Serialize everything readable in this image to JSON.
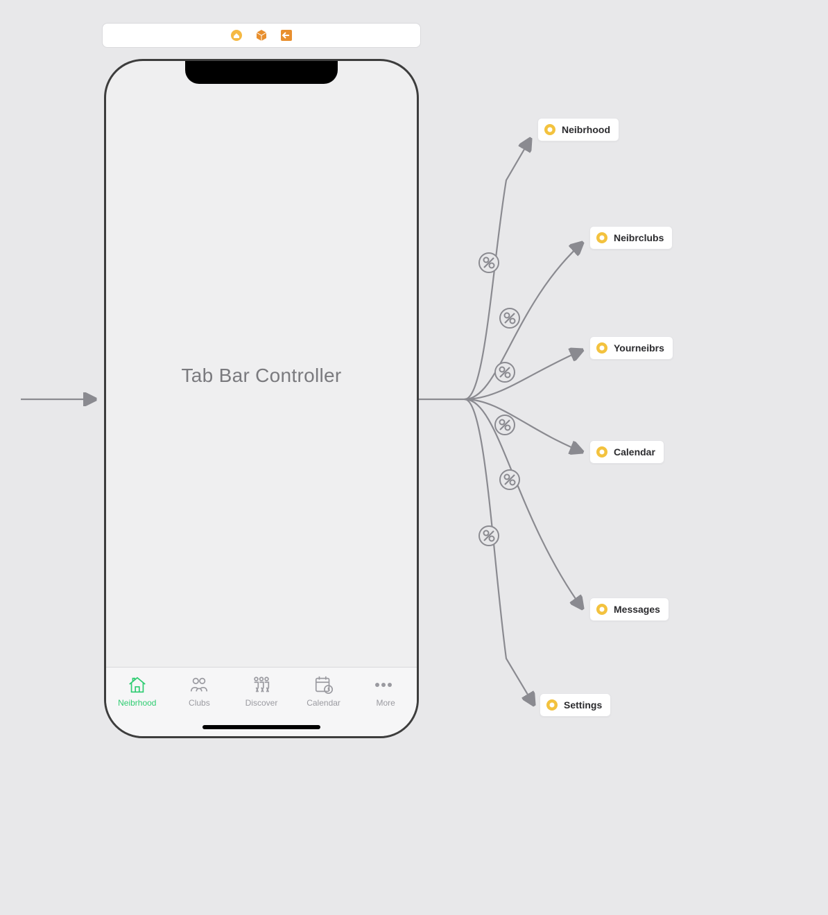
{
  "toolbar": {
    "icons": [
      "home-circle-icon",
      "cube-icon",
      "exit-icon"
    ]
  },
  "device": {
    "center_label": "Tab Bar Controller",
    "tabs": [
      {
        "label": "Neibrhood",
        "icon": "house-icon",
        "active": true
      },
      {
        "label": "Clubs",
        "icon": "people-group-icon",
        "active": false
      },
      {
        "label": "Discover",
        "icon": "figures-icon",
        "active": false
      },
      {
        "label": "Calendar",
        "icon": "calendar-clock-icon",
        "active": false
      },
      {
        "label": "More",
        "icon": "more-dots-icon",
        "active": false
      }
    ]
  },
  "targets": [
    {
      "label": "Neibrhood"
    },
    {
      "label": "Neibrclubs"
    },
    {
      "label": "Yourneibrs"
    },
    {
      "label": "Calendar"
    },
    {
      "label": "Messages"
    },
    {
      "label": "Settings"
    }
  ]
}
